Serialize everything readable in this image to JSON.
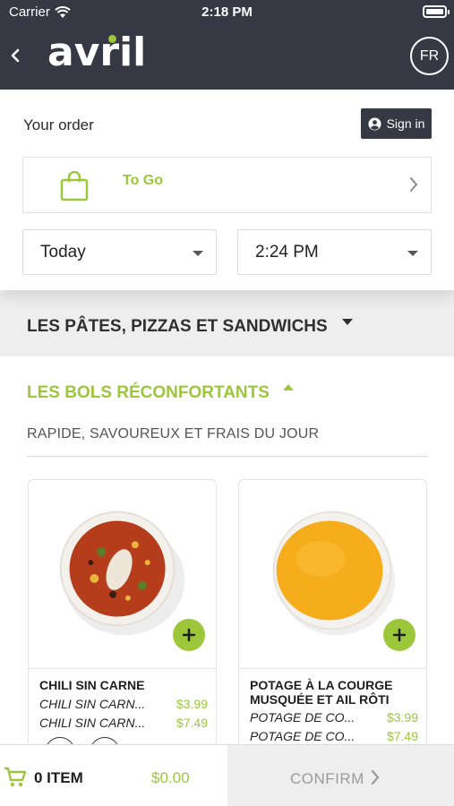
{
  "status_bar": {
    "carrier": "Carrier",
    "time": "2:18 PM"
  },
  "header": {
    "logo": "avril",
    "language": "FR"
  },
  "order": {
    "title": "Your order",
    "sign_in": "Sign in",
    "mode": "To Go",
    "day": "Today",
    "time": "2:24 PM"
  },
  "categories": [
    {
      "label": "LES PÂTES, PIZZAS ET SANDWICHS",
      "expanded": false
    },
    {
      "label": "LES BOLS RÉCONFORTANTS",
      "expanded": true,
      "subtitle": "RAPIDE, SAVOUREUX ET FRAIS DU JOUR"
    }
  ],
  "products": [
    {
      "name": "CHILI SIN CARNE",
      "variants": [
        {
          "name": "CHILI SIN CARN...",
          "price": "$3.99"
        },
        {
          "name": "CHILI SIN CARN...",
          "price": "$7.49"
        }
      ]
    },
    {
      "name": "POTAGE À LA COURGE MUSQUÉE ET AIL RÔTI",
      "variants": [
        {
          "name": "POTAGE DE CO...",
          "price": "$3.99"
        },
        {
          "name": "POTAGE DE CO...",
          "price": "$7.49"
        }
      ]
    }
  ],
  "cart": {
    "count_label": "0 ITEM",
    "total": "$0.00",
    "confirm": "CONFIRM"
  },
  "colors": {
    "accent": "#9cc73b",
    "header_bg": "#363944",
    "category_bg": "#eeeeee"
  }
}
